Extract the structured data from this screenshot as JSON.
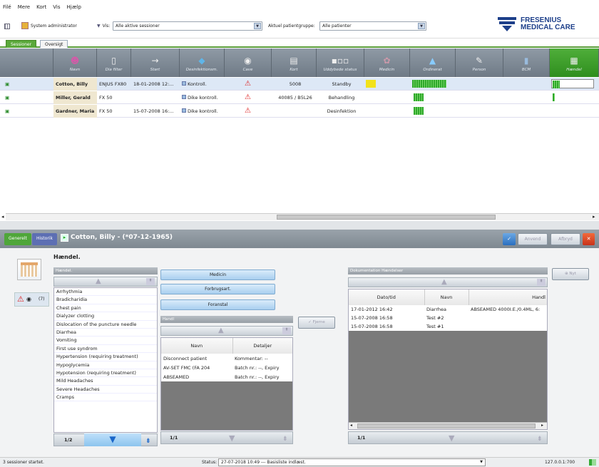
{
  "menu": [
    "Filé",
    "Mere",
    "Kort",
    "Vis",
    "Hjælp"
  ],
  "toolbar": {
    "user_label": "System administrator",
    "view_label": "Vis:",
    "view_value": "Alle aktive sessioner",
    "group_label": "Aktuel patientgruppe:",
    "group_value": "Alle patienter"
  },
  "logo": {
    "line1": "FRESENIUS",
    "line2": "MEDICAL CARE",
    "color": "#1d3f8a"
  },
  "tabs": [
    "Sessioner",
    "Oversigt"
  ],
  "columns": [
    {
      "label": "Navn",
      "icon": "people-icon"
    },
    {
      "label": "Dia filter",
      "icon": "filter-icon"
    },
    {
      "label": "Start",
      "icon": "arrow-right-icon"
    },
    {
      "label": "Desinfektionsm.",
      "icon": "disinfection-icon"
    },
    {
      "label": "Cave",
      "icon": "eye-icon"
    },
    {
      "label": "Kort",
      "icon": "card-icon"
    },
    {
      "label": "Uddybede status",
      "icon": "status-icon"
    },
    {
      "label": "Medicin",
      "icon": "medicine-icon"
    },
    {
      "label": "Ordinerat",
      "icon": "prescription-icon"
    },
    {
      "label": "Person",
      "icon": "person-icon"
    },
    {
      "label": "BCM",
      "icon": "bcm-icon"
    },
    {
      "label": "Hændel",
      "icon": "event-icon"
    }
  ],
  "rows": [
    {
      "name": "Cotton, Billy",
      "filter": "ENJUS FX80",
      "start": "18-01-2008 12:...",
      "disinf": "Kontroll.",
      "card": "5008",
      "status": "Standby"
    },
    {
      "name": "Miller, Gerald",
      "filter": "FX 50",
      "start": "",
      "disinf": "Dike kontroll.",
      "card": "40085 / B5L26",
      "status": "Behandling"
    },
    {
      "name": "Gardner, Maria",
      "filter": "FX 50",
      "start": "15-07-2008 16:...",
      "disinf": "Dike kontroll.",
      "card": "",
      "status": "Desinfektion"
    }
  ],
  "bottom": {
    "tab_general": "Generelt",
    "tab_history": "Historik",
    "patient": "Cotton, Billy - (*07-12-1965)",
    "apply": "Anvend",
    "cancel": "Afbryd",
    "section_title": "Hændel.",
    "cave_count": "(7)"
  },
  "events_panel": {
    "header": "Hændel.",
    "items": [
      "Arrhythmia",
      "Bradicharidia",
      "Chest pain",
      "Dialyzer clotting",
      "Dislocation of the puncture needle",
      "Diarrhea",
      "Vomiting",
      "First use syndrom",
      "Hypertension (requiring treatment)",
      "Hypoglycemia",
      "Hypotension (requiring treatment)",
      "Mild Headaches",
      "Severe Headaches",
      "Cramps"
    ],
    "pager": "1/2"
  },
  "middle": {
    "btn_medicin": "Medicin",
    "btn_forbrug": "Forbrugsart.",
    "btn_foranstalt": "Foranstal",
    "handl_header": "Handl",
    "col_name": "Navn",
    "col_details": "Detaljer",
    "items": [
      {
        "name": "Disconnect patient",
        "details": "Kommentar: --"
      },
      {
        "name": "AV-SET FMC (FA 204",
        "details": "Batch nr.: --, Expiry"
      },
      {
        "name": "ABSEAMED",
        "details": "Batch nr.: --, Expiry"
      }
    ],
    "delete_btn": "Fjerne",
    "pager": "1/1"
  },
  "doc_panel": {
    "header": "Dokumentation Hændelser",
    "new_btn": "Nyt",
    "col_date": "Dato/tid",
    "col_name": "Navn",
    "col_handl": "Handl",
    "rows": [
      {
        "date": "17-01-2012 16:42",
        "name": "Diarrhea",
        "handl": "ABSEAMED 4000I.E./0.4ML, 6:"
      },
      {
        "date": "15-07-2008 16:58",
        "name": "Test #2",
        "handl": ""
      },
      {
        "date": "15-07-2008 16:58",
        "name": "Test #1",
        "handl": ""
      }
    ],
    "pager": "1/1"
  },
  "statusbar": {
    "left": "3 sessioner startet.",
    "status_label": "Status:",
    "status_value": "27-07-2018 10:49 --- Basisliste indlæst.",
    "ip": "127.0.0.1:700"
  }
}
